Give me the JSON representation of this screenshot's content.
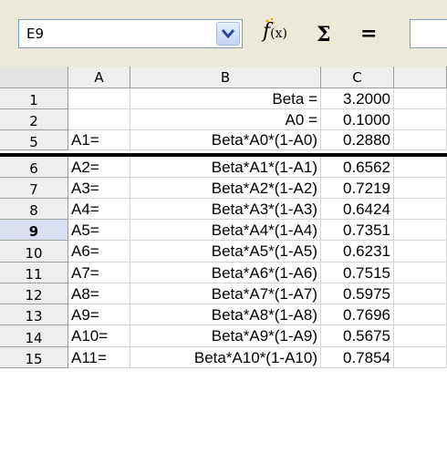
{
  "formula_bar": {
    "name_box": "E9",
    "function_wizard_icon": "fx-icon",
    "sum_icon": "Σ",
    "equals_icon": "=",
    "formula": ""
  },
  "columns": [
    "A",
    "B",
    "C"
  ],
  "rows": [
    {
      "num": "1",
      "a": "",
      "b": "Beta =",
      "c": "3.2000"
    },
    {
      "num": "2",
      "a": "",
      "b": "A0 =",
      "c": "0.1000"
    },
    {
      "num": "5",
      "a": "A1=",
      "b": "Beta*A0*(1-A0)",
      "c": "0.2880"
    },
    {
      "num": "6",
      "a": "A2=",
      "b": "Beta*A1*(1-A1)",
      "c": "0.6562"
    },
    {
      "num": "7",
      "a": "A3=",
      "b": "Beta*A2*(1-A2)",
      "c": "0.7219"
    },
    {
      "num": "8",
      "a": "A4=",
      "b": "Beta*A3*(1-A3)",
      "c": "0.6424"
    },
    {
      "num": "9",
      "a": "A5=",
      "b": "Beta*A4*(1-A4)",
      "c": "0.7351"
    },
    {
      "num": "10",
      "a": "A6=",
      "b": "Beta*A5*(1-A5)",
      "c": "0.6231"
    },
    {
      "num": "11",
      "a": "A7=",
      "b": "Beta*A6*(1-A6)",
      "c": "0.7515"
    },
    {
      "num": "12",
      "a": "A8=",
      "b": "Beta*A7*(1-A7)",
      "c": "0.5975"
    },
    {
      "num": "13",
      "a": "A9=",
      "b": "Beta*A8*(1-A8)",
      "c": "0.7696"
    },
    {
      "num": "14",
      "a": "A10=",
      "b": "Beta*A9*(1-A9)",
      "c": "0.5675"
    },
    {
      "num": "15",
      "a": "A11=",
      "b": "Beta*A10*(1-A10)",
      "c": "0.7854"
    }
  ],
  "selected_row": "9"
}
